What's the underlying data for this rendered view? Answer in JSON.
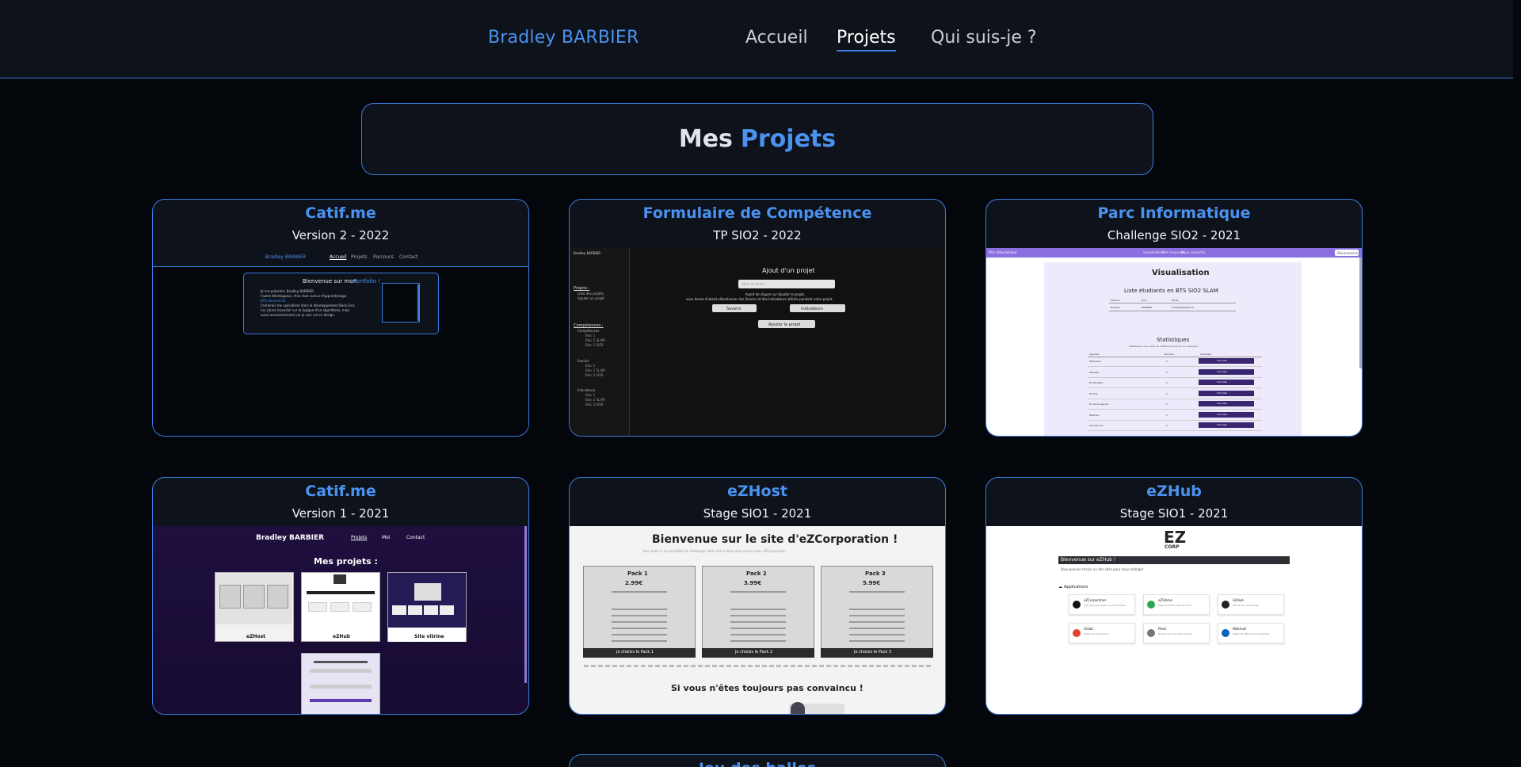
{
  "nav": {
    "brand": "Bradley BARBIER",
    "links": [
      "Accueil",
      "Projets",
      "Qui suis-je ?"
    ]
  },
  "heading": {
    "part1": "Mes",
    "part2": "Projets"
  },
  "colors": {
    "accent": "#4a92f0",
    "border": "#3b7de0",
    "card_bg": "#0e121a",
    "page_bg": "#03060b"
  },
  "projects": [
    {
      "title": "Catif.me",
      "subtitle": "Version 2 - 2022",
      "preview": {
        "brand": "Bradley BARBIER",
        "nav": [
          "Accueil",
          "Projets",
          "Parcours",
          "Contact"
        ],
        "welcome": "Bienvenue sur mon",
        "welcome_hl": "Portfolio !",
        "lines": [
          "Je me présente, Bradley BARBIER,",
          "l'autre développeur, d'où mon cursus d'apprentissage.",
          "BTS Services IG",
          "J'aimerais me spécialiser dans le développement Back End,",
          "car j'aime travailler sur la logique d'un algorithme, mais",
          "aussi accessoirement car je suis nul en design."
        ]
      }
    },
    {
      "title": "Formulaire de Compétence",
      "subtitle": "TP SIO2 - 2022",
      "preview": {
        "brand": "Bradley BARBIER",
        "side": [
          "Projets :",
          "Liste des projets",
          "Ajouter un projet",
          "Compétences :",
          "Compétences",
          "Bloc 1",
          "Bloc 2 SLAM",
          "Bloc 3 SISR",
          "Savoirs",
          "Bloc 1",
          "Bloc 2 SLAM",
          "Bloc 3 SISR",
          "Indicateurs",
          "Bloc 1",
          "Bloc 2 SLAM",
          "Bloc 3 SISR"
        ],
        "form_title": "Ajout d'un projet",
        "input_placeholder": "Nom du Projet",
        "help1": "Avant de cliquer sur Ajouter le projet,",
        "help2": "vous devez d'abord sélectionner des Savoirs et des Indicateurs utilisés pendant votre projet.",
        "btn_savoirs": "Savoirs",
        "btn_indicateurs": "Indicateurs",
        "btn_add": "Ajouter le projet"
      }
    },
    {
      "title": "Parc Informatique",
      "subtitle": "Challenge SIO2 - 2021",
      "preview": {
        "topbar_title": "Parc Informatique",
        "topbar_links": [
          "Visualisation",
          "Mes emprunts",
          "Nous contacter"
        ],
        "topbar_btn": "Déconnexion",
        "h1": "Visualisation",
        "h2": "Liste étudiants en BTS SIO2 SLAM",
        "student_cols": [
          "Prénom",
          "Nom",
          "Email"
        ],
        "student_row": [
          "Bradley",
          "BARBIER",
          "bradley@barbier.fr"
        ],
        "stats_title": "Statistiques",
        "stats_sub": "Statistiques des outils les différents produits du catalogue",
        "stats_cols": [
          "Appareil",
          "Nombre",
          "Visualiser"
        ],
        "rows": [
          "Téléphone",
          "Tablette",
          "PC Portable",
          "PC Fixe",
          "PC de la régione",
          "Webcam",
          "Microphone"
        ],
        "btn": "Voir liste"
      }
    },
    {
      "title": "Catif.me",
      "subtitle": "Version 1 - 2021",
      "preview": {
        "brand": "Bradley BARBIER",
        "nav": [
          "Projets",
          "Moi",
          "Contact"
        ],
        "heading": "Mes projets :",
        "tiles": [
          "eZHost",
          "eZHub",
          "Site vitrine"
        ]
      }
    },
    {
      "title": "eZHost",
      "subtitle": "Stage SIO1 - 2021",
      "preview": {
        "heading": "Bienvenue sur le site d'eZCorporation !",
        "subheading": "Vous avez ici la possibilité de l'héberger votre site et bien plus encore avec eZCorporation",
        "packs": [
          {
            "name": "Pack 1",
            "price": "2.99€"
          },
          {
            "name": "Pack 2",
            "price": "3.99€"
          },
          {
            "name": "Pack 3",
            "price": "5.99€"
          }
        ],
        "pack_btn_prefix": "Je choisis le ",
        "footer_line": "Si vous n'êtes toujours pas convaincu !"
      }
    },
    {
      "title": "eZHub",
      "subtitle": "Stage SIO1 - 2021",
      "preview": {
        "logo_top": "EZ",
        "logo_bottom": "CORP",
        "banner": "Bienvenue sur eZHub !",
        "intro": "Vous pouvez choisir un des sites pour vous rediriger",
        "apps_title": "Applications",
        "apps": [
          {
            "name": "eZCorporation",
            "desc": "Site de présentation de l'entreprise"
          },
          {
            "name": "eZStatus",
            "desc": "Page de statut des services"
          },
          {
            "name": "GitHub",
            "desc": "GitHub de l'entreprise"
          },
          {
            "name": "Gitlab",
            "desc": "Gitlab de l'entreprise"
          },
          {
            "name": "Plesk",
            "desc": "Gestion de nos sites internet"
          },
          {
            "name": "Webmail",
            "desc": "Webmail officiel de l'entreprise"
          }
        ]
      }
    },
    {
      "title": "Jeu des balles",
      "subtitle": ""
    }
  ]
}
